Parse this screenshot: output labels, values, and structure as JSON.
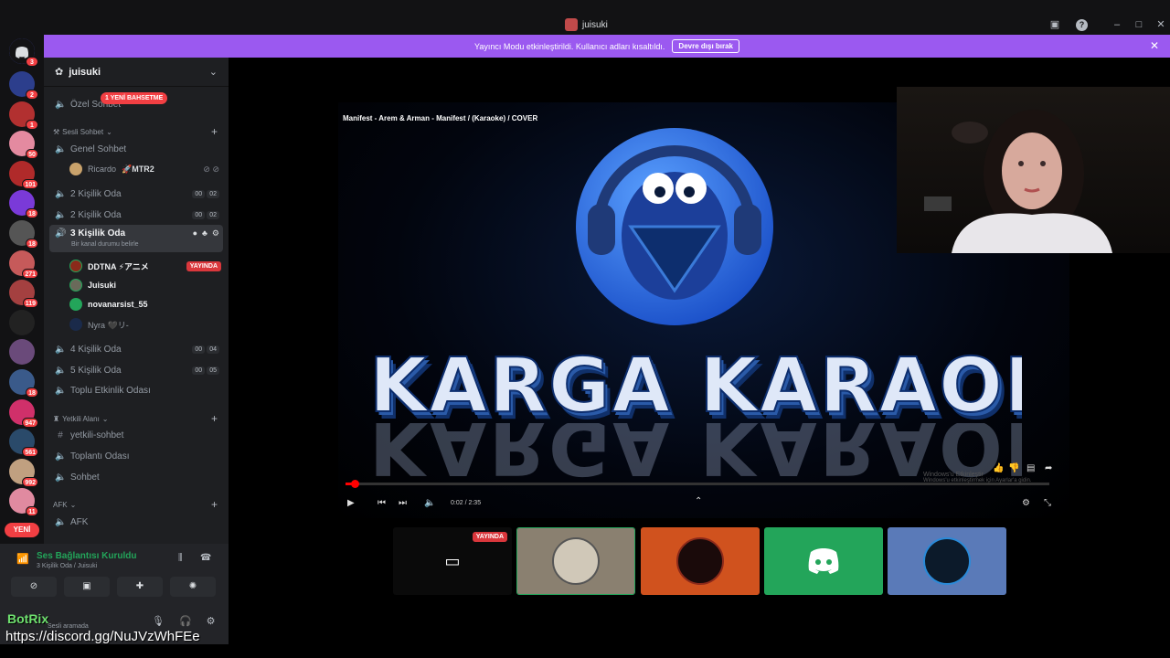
{
  "window": {
    "title": "juisuki"
  },
  "banner": {
    "text": "Yayıncı Modu etkinleştirildi. Kullanıcı adları kısaltıldı.",
    "button": "Devre dışı bırak"
  },
  "rail": {
    "home_badge": "3",
    "servers": [
      {
        "badge": "2",
        "color": "#2c3e8c"
      },
      {
        "badge": "1",
        "color": "#b23030"
      },
      {
        "badge": "50",
        "color": "#e48aa0"
      },
      {
        "badge": "101",
        "color": "#b02a2a"
      },
      {
        "badge": "18",
        "color": "#7a3ad8"
      },
      {
        "badge": "18",
        "color": "#555555"
      },
      {
        "badge": "271",
        "color": "#c65a5a"
      },
      {
        "badge": "119",
        "color": "#a44040"
      },
      {
        "badge": "",
        "color": "#222222"
      },
      {
        "badge": "",
        "color": "#6a4a7a"
      },
      {
        "badge": "18",
        "color": "#3a5a8a"
      },
      {
        "badge": "947",
        "color": "#d0306a"
      },
      {
        "badge": "561",
        "color": "#2a4a6a"
      },
      {
        "badge": "992",
        "color": "#c0a080"
      },
      {
        "badge": "11",
        "color": "#e08aa0"
      }
    ],
    "new_label": "YENİ"
  },
  "sidebar": {
    "server_name": "juisuki",
    "mention_pill": "1 YENİ BAHSETME",
    "private_channel": "Özel Sohbet",
    "voice_category": "Sesli Sohbet",
    "channels_top": [
      {
        "name": "Genel Sohbet"
      }
    ],
    "genel_user": {
      "name": "Ricardo",
      "tag": "🚀MTR2"
    },
    "rooms": [
      {
        "name": "2 Kişilik Oda",
        "a": "00",
        "b": "02"
      },
      {
        "name": "2 Kişilik Oda",
        "a": "00",
        "b": "02"
      }
    ],
    "active_room": {
      "name": "3 Kişilik Oda",
      "sub": "Bir kanal durumu belirle"
    },
    "active_users": [
      {
        "name": "DDTNA ⚡アニメ",
        "live": "YAYINDA"
      },
      {
        "name": "Juisuki"
      },
      {
        "name": "novanarsist_55"
      },
      {
        "name": "Nyra 🖤リ-"
      }
    ],
    "rooms2": [
      {
        "name": "4 Kişilik Oda",
        "a": "00",
        "b": "04"
      },
      {
        "name": "5 Kişilik Oda",
        "a": "00",
        "b": "05"
      }
    ],
    "topluluk": "Toplu Etkinlik Odası",
    "yetkili_category": "Yetkili Alanı",
    "yetkili_channels": [
      "yetkili-sohbet",
      "Toplantı Odası",
      "Sohbet"
    ],
    "afk_category": "AFK",
    "afk_channel": "AFK"
  },
  "voice_panel": {
    "title": "Ses Bağlantısı Kuruldu",
    "sub": "3 Kişilik Oda / Juisuki"
  },
  "user_panel": {
    "overlay": "BotRix",
    "status": "Sesli aramada",
    "link": "https://discord.gg/NuJVzWhFEe"
  },
  "video": {
    "title": "Manifest - Arem & Arman - Manifest / (Karaoke)  / COVER",
    "text": "KARGA KARAOKE",
    "time": "0:02 / 2:35",
    "progress": 0.013,
    "watermark_1": "Windows'u Etkinleştir",
    "watermark_2": "Windows'u etkinleştirmek için Ayarlar'a gidin."
  },
  "thumbnails": [
    {
      "live": "YAYINDA",
      "color": "#0a0a0a"
    },
    {
      "color": "#8a8070"
    },
    {
      "color": "#d0521e"
    },
    {
      "color": "#23a55a"
    },
    {
      "color": "#5a7ab8"
    }
  ]
}
